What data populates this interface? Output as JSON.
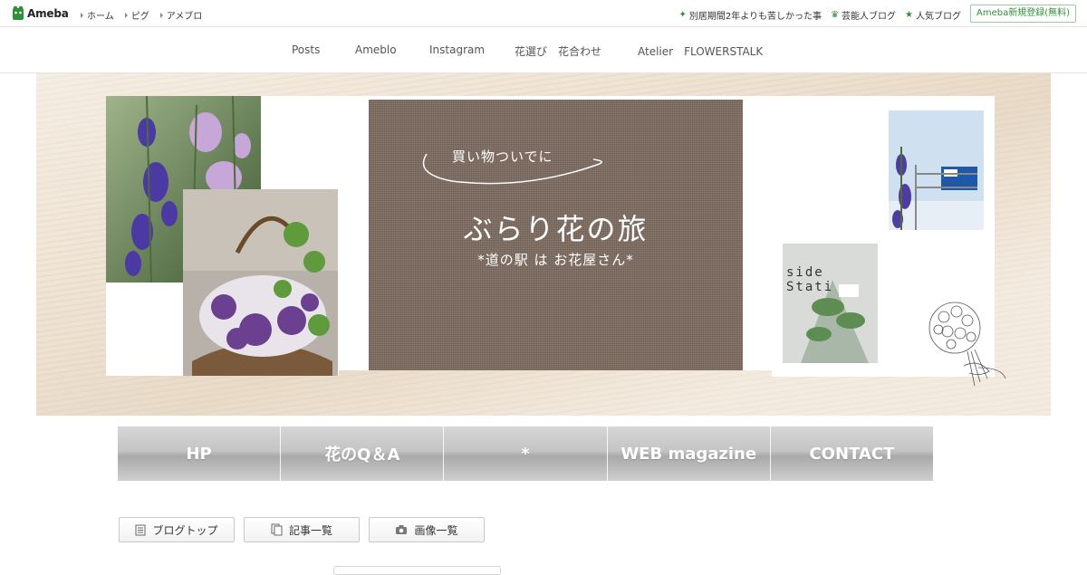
{
  "ameba": {
    "logo_text": "Ameba",
    "left_links": [
      "ホーム",
      "ピグ",
      "アメブロ"
    ],
    "right_links": [
      {
        "label": "別居期間2年よりも苦しかった事",
        "icon": "sparkle-icon"
      },
      {
        "label": "芸能人ブログ",
        "icon": "crown-icon"
      },
      {
        "label": "人気ブログ",
        "icon": "star-icon"
      }
    ],
    "register_label": "Ameba新規登録(無料)",
    "accent": "#2f8f3a"
  },
  "blog_nav": [
    "Posts",
    "Ameblo",
    "Instagram",
    "花選び　花合わせ",
    "Atelier　FLOWERSTALK"
  ],
  "header": {
    "subtitle": "買い物ついでに",
    "title": "ぶらり花の旅",
    "tagline": "*道の駅 は お花屋さん*",
    "photo_sign_text": "side Stati"
  },
  "menu": [
    "HP",
    "花のQ＆A",
    "*",
    "WEB magazine",
    "CONTACT"
  ],
  "sub_buttons": [
    {
      "label": "ブログトップ",
      "icon": "document-icon"
    },
    {
      "label": "記事一覧",
      "icon": "pages-icon"
    },
    {
      "label": "画像一覧",
      "icon": "camera-icon"
    }
  ]
}
